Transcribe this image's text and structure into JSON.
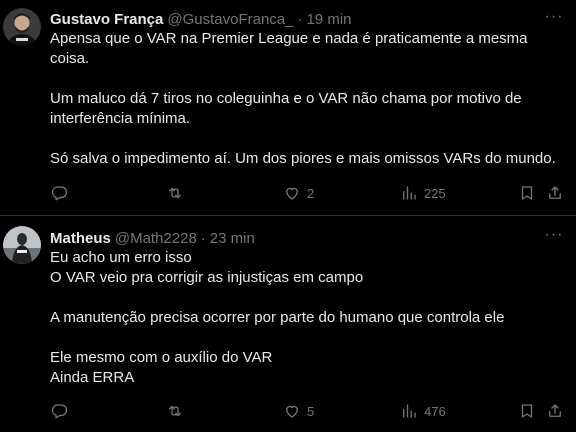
{
  "tweets": [
    {
      "name": "Gustavo França",
      "handle": "@GustavoFranca_",
      "separator": "·",
      "time": "19 min",
      "lines": [
        "Apensa que o VAR na Premier League e nada é praticamente a mesma",
        "coisa.",
        "",
        "Um maluco dá 7 tiros no coleguinha e o VAR não chama por motivo de",
        "interferência mínima.",
        "",
        "Só salva o impedimento aí. Um dos piores e mais omissos VARs do mundo."
      ],
      "replies": "",
      "retweets": "",
      "likes": "2",
      "views": "225"
    },
    {
      "name": "Matheus",
      "handle": "@Math2228",
      "separator": "·",
      "time": "23 min",
      "lines": [
        "Eu acho um erro isso",
        "O VAR veio pra corrigir as injustiças em campo",
        "",
        "A manutenção precisa ocorrer por parte do humano que controla ele",
        "",
        "Ele mesmo com o auxílio do VAR",
        "Ainda ERRA"
      ],
      "replies": "",
      "retweets": "",
      "likes": "5",
      "views": "476"
    }
  ],
  "more_glyph": "···",
  "icons": [
    "reply-icon",
    "retweet-icon",
    "like-icon",
    "views-icon",
    "bookmark-icon",
    "share-icon"
  ],
  "colors": {
    "background": "#000000",
    "text": "#e7e9ea",
    "muted": "#71767b",
    "divider": "#2f3336"
  }
}
